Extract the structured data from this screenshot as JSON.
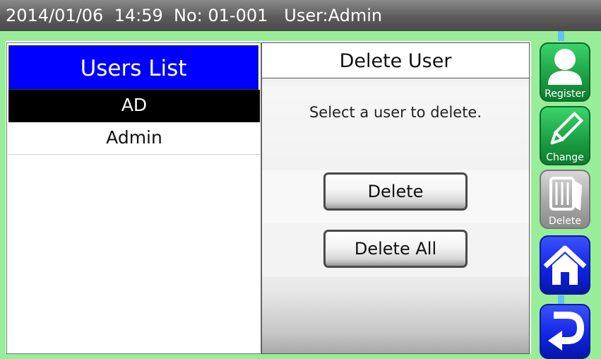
{
  "status_bar": {
    "date": "2014/01/06",
    "time": "14:59",
    "number": "No: 01-001",
    "user": "User:Admin"
  },
  "users_panel": {
    "title": "Users List",
    "users": [
      "AD",
      "Admin"
    ]
  },
  "delete_panel": {
    "title": "Delete User",
    "prompt": "Select a user to delete.",
    "delete_label": "Delete",
    "delete_all_label": "Delete All"
  },
  "side_nav": {
    "register_label": "Register",
    "change_label": "Change",
    "delete_label": "Delete",
    "home_icon": "home-icon",
    "back_icon": "return-arrow-icon"
  },
  "colors": {
    "frame": "#98ee98",
    "header_blue": "#0000ff",
    "nav_green": "#1b9e43",
    "nav_blue": "#0f22e0"
  }
}
